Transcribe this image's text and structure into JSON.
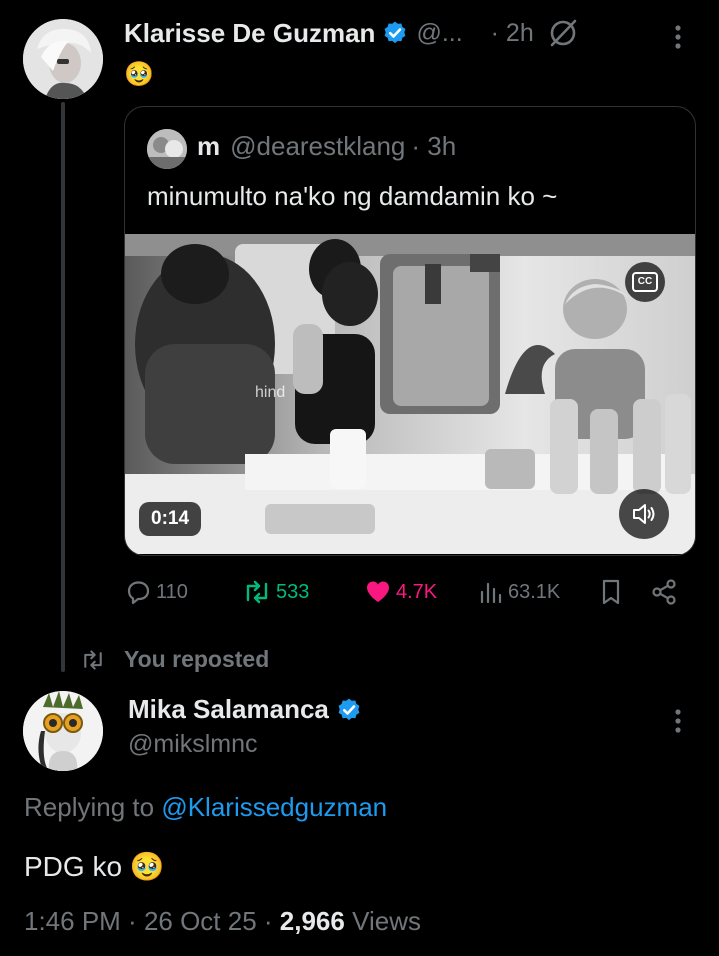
{
  "tweet1": {
    "author_name": "Klarisse De Guzman",
    "handle": "@...",
    "time": "· 2h",
    "text": "🥹"
  },
  "quoted": {
    "author_name": "m",
    "handle": "@dearestklang",
    "time": "· 3h",
    "text": "minumulto na'ko ng damdamin ko ~",
    "video": {
      "duration": "0:14",
      "cc_label": "CC",
      "caption_overlay": "hind"
    }
  },
  "actions": {
    "replies": "110",
    "reposts": "533",
    "likes": "4.7K",
    "views": "63.1K",
    "colors": {
      "repost": "#00ba7c",
      "like": "#f91880",
      "default": "#71767b"
    }
  },
  "repost_context": {
    "label": "You reposted"
  },
  "tweet2": {
    "author_name": "Mika Salamanca",
    "handle": "@mikslmnc",
    "replying_prefix": "Replying to ",
    "replying_handle": "@Klarissedguzman",
    "text": "PDG ko 🥹",
    "time": "1:46 PM",
    "date": "26 Oct 25",
    "views_count": "2,966",
    "views_label": "Views"
  },
  "theme": {
    "accent": "#1d9bf0",
    "background": "#000000",
    "divider": "#2f3336"
  }
}
